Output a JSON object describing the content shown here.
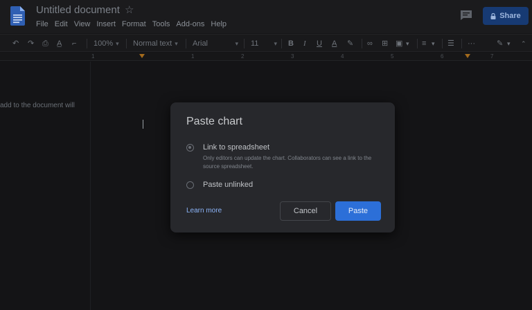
{
  "header": {
    "doc_title": "Untitled document",
    "share_label": "Share",
    "menu": [
      "File",
      "Edit",
      "View",
      "Insert",
      "Format",
      "Tools",
      "Add-ons",
      "Help"
    ]
  },
  "toolbar": {
    "zoom": "100%",
    "style": "Normal text",
    "font": "Arial",
    "size": "11"
  },
  "ruler": {
    "numbers": [
      "1",
      "1",
      "2",
      "3",
      "4",
      "5",
      "6",
      "7"
    ]
  },
  "document": {
    "body_text": "add to the document will"
  },
  "dialog": {
    "title": "Paste chart",
    "option_link_label": "Link to spreadsheet",
    "option_link_desc": "Only editors can update the chart. Collaborators can see a link to the source spreadsheet.",
    "option_unlinked_label": "Paste unlinked",
    "learn_more": "Learn more",
    "cancel_label": "Cancel",
    "paste_label": "Paste"
  },
  "colors": {
    "accent": "#2c6fd8",
    "link": "#8cb4f8",
    "share": "#173a73"
  }
}
